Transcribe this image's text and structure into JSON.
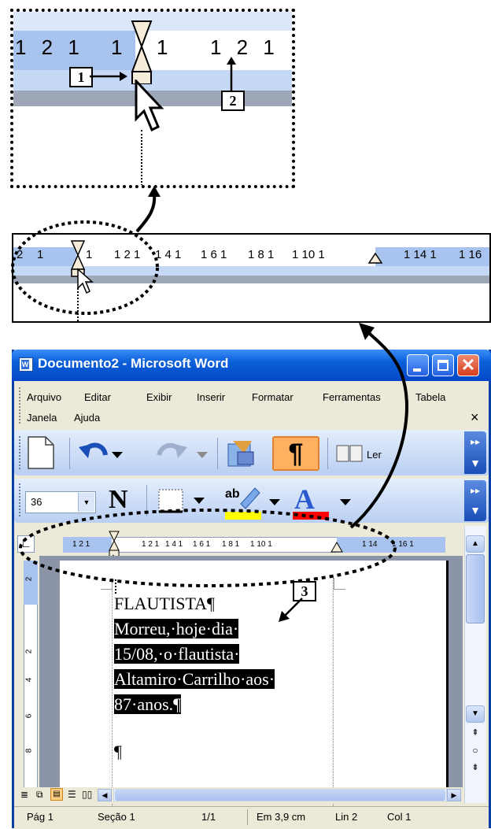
{
  "window": {
    "title": "Documento2 - Microsoft Word"
  },
  "menu": {
    "row1": [
      "Arquivo",
      "Editar",
      "Exibir",
      "Inserir",
      "Formatar",
      "Ferramentas",
      "Tabela"
    ],
    "row2": [
      "Janela",
      "Ajuda"
    ],
    "close_glyph": "×"
  },
  "toolbar": {
    "read_label": "Ler",
    "font_size": "36",
    "bold_label": "N"
  },
  "rulers": {
    "zoom_top": [
      "1 2 1",
      "1",
      "1 2 1"
    ],
    "zoom_mid": [
      "2",
      "1",
      "1 2 1",
      "1 4 1",
      "1 6 1",
      "1 8 1",
      "1 10 1",
      "1 14 1",
      "1 16"
    ],
    "main": [
      "1 2 1",
      "1 2 1",
      "1 4 1",
      "1 6 1",
      "1 8 1",
      "1 10 1",
      "1 14",
      "1 16 1"
    ],
    "vertical": [
      "2",
      "2",
      "4",
      "6",
      "8"
    ]
  },
  "document": {
    "lines": [
      "FLAUTISTA¶",
      "Morreu,·hoje·dia·",
      "15/08,·o·flautista·",
      "Altamiro·Carrilho·aos·",
      "87·anos.¶",
      "¶"
    ]
  },
  "callouts": {
    "one": "1",
    "two": "2",
    "three": "3"
  },
  "status": {
    "page": "Pág 1",
    "section": "Seção 1",
    "pages": "1/1",
    "position": "Em 3,9 cm",
    "line": "Lin 2",
    "col": "Col 1"
  },
  "colors": {
    "title_bar": "#0a5fd8",
    "window_bg": "#ece9d8",
    "toolbar_bg": "#c5d8f5",
    "ruler_blue": "#a8c4ee",
    "highlight_yellow": "#ffff00",
    "font_red": "#ff0000"
  }
}
